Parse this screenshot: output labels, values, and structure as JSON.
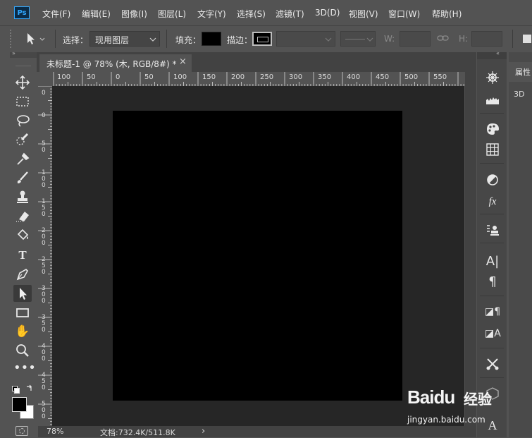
{
  "app": {
    "logo": "Ps"
  },
  "menu": [
    "文件(F)",
    "编辑(E)",
    "图像(I)",
    "图层(L)",
    "文字(Y)",
    "选择(S)",
    "滤镜(T)",
    "3D(D)",
    "视图(V)",
    "窗口(W)",
    "帮助(H)"
  ],
  "options": {
    "select_label": "选择：",
    "select_value": "现用图层",
    "fill_label": "填充：",
    "fill_color": "#000000",
    "stroke_label": "描边：",
    "w_label": "W:",
    "h_label": "H:"
  },
  "document": {
    "tab_title": "未标题-1 @ 78% (木, RGB/8#) *",
    "close": "×",
    "artboard_color": "#000000"
  },
  "rulers": {
    "top": [
      "100",
      "50",
      "0",
      "50",
      "100",
      "150",
      "200",
      "250",
      "300",
      "350",
      "400",
      "450",
      "500",
      "550"
    ],
    "left": [
      "0",
      "0",
      "50",
      "100",
      "150",
      "200",
      "250",
      "300",
      "350",
      "400",
      "450",
      "500"
    ]
  },
  "status": {
    "zoom": "78%",
    "doc_info": "文档:732.4K/511.8K",
    "arrow": "›"
  },
  "panels": {
    "properties_tab": "属性",
    "panel_3d": "3D"
  },
  "colors": {
    "foreground": "#000000",
    "background": "#ffffff",
    "accent": "#31a8ff"
  },
  "watermark": {
    "brand": "Baidu",
    "cn": "经验",
    "url": "jingyan.baidu.com"
  },
  "tools": [
    "move-icon",
    "marquee-icon",
    "lasso-icon",
    "quick-select-icon",
    "eyedropper-icon",
    "brush-icon",
    "stamp-icon",
    "eraser-icon",
    "paint-bucket-icon",
    "type-icon",
    "pen-icon",
    "path-select-icon",
    "rectangle-icon",
    "hand-icon",
    "zoom-icon",
    "more-icon"
  ],
  "dock_icons": [
    "navigator-icon",
    "histogram-icon",
    "color-icon",
    "swatches-icon",
    "adjustments-icon",
    "styles-icon",
    "layer-comps-icon",
    "character-icon",
    "paragraph-icon",
    "paragraph-styles-icon",
    "character-styles-icon",
    "tools-preset-icon",
    "3d-icon",
    "type-a-icon"
  ]
}
